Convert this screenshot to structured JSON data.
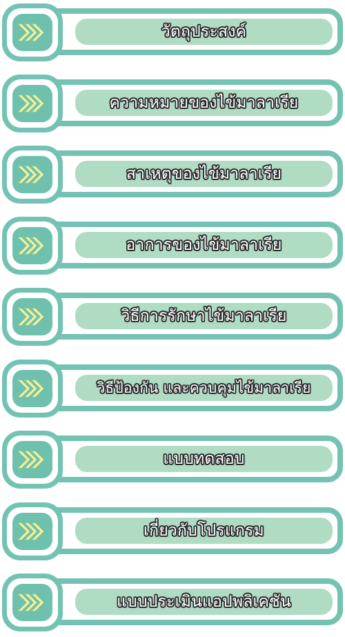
{
  "colors": {
    "frame": "#74c3b2",
    "icon_fill": "#6fc1ae",
    "label_pill": "#b0dcc4",
    "arrow": "#f4f7a8"
  },
  "menu": {
    "icon": "fast-forward-arrows-icon",
    "items": [
      {
        "label": "วัตถุประสงค์"
      },
      {
        "label": "ความหมายของไข้มาลาเรีย"
      },
      {
        "label": "สาเหตุของไข้มาลาเรีย"
      },
      {
        "label": "อาการของไข้มาลาเรีย"
      },
      {
        "label": "วิธีการรักษาไข้มาลาเรีย"
      },
      {
        "label": "วิธีป้องกัน และควบคุมไข้มาลาเรีย"
      },
      {
        "label": "แบบทดสอบ"
      },
      {
        "label": "เกี่ยวกับโปรแกรม"
      },
      {
        "label": "แบบประเมินแอปพลิเคชัน"
      }
    ]
  }
}
